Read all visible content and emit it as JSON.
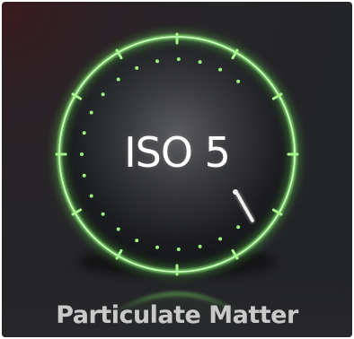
{
  "gauge": {
    "value_label": "ISO 5",
    "caption": "Particulate Matter"
  },
  "icons": {
    "gauge_needle": "needle-icon"
  },
  "colors": {
    "panel_background": "#232427",
    "ring_glow": "#8df27a",
    "ring_core": "#d9ffc9",
    "tick_color": "#9cf27f",
    "text_primary": "#ffffff",
    "caption_text": "#c9c9c9"
  }
}
